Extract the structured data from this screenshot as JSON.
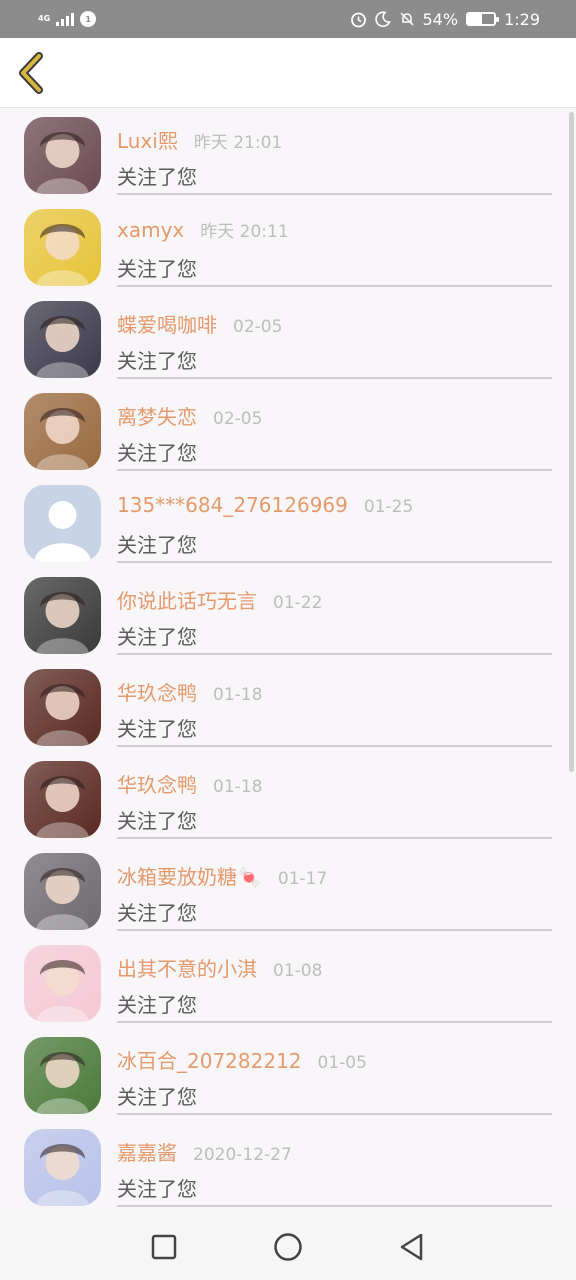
{
  "status_bar": {
    "network": "4G",
    "notification_badge": "1",
    "battery": "54%",
    "battery_level": 0.54,
    "time": "1:29"
  },
  "header": {
    "back_icon": "chevron-left-icon",
    "accent": "#d8b640"
  },
  "items": [
    {
      "name": "Luxi熙",
      "time": "昨天 21:01",
      "action": "关注了您",
      "avatar_color": "#6b4a52"
    },
    {
      "name": "xamyx",
      "time": "昨天 20:11",
      "action": "关注了您",
      "avatar_color": "#e8c43a"
    },
    {
      "name": "蝶爱喝咖啡",
      "time": "02-05",
      "action": "关注了您",
      "avatar_color": "#3b3a4a"
    },
    {
      "name": "离梦失恋",
      "time": "02-05",
      "action": "关注了您",
      "avatar_color": "#9a6a3e"
    },
    {
      "name": "135***684_276126969",
      "time": "01-25",
      "action": "关注了您",
      "avatar_color": "#c9d3e6"
    },
    {
      "name": "你说此话巧无言",
      "time": "01-22",
      "action": "关注了您",
      "avatar_color": "#3a3a3a"
    },
    {
      "name": "华玖念鸭",
      "time": "01-18",
      "action": "关注了您",
      "avatar_color": "#5a2a22"
    },
    {
      "name": "华玖念鸭",
      "time": "01-18",
      "action": "关注了您",
      "avatar_color": "#5a2a22"
    },
    {
      "name": "冰箱要放奶糖🍬",
      "time": "01-17",
      "action": "关注了您",
      "avatar_color": "#6d6a70"
    },
    {
      "name": "出其不意的小淇",
      "time": "01-08",
      "action": "关注了您",
      "avatar_color": "#f5c9d6"
    },
    {
      "name": "冰百合_207282212",
      "time": "01-05",
      "action": "关注了您",
      "avatar_color": "#4b7a3a"
    },
    {
      "name": "嘉嘉酱",
      "time": "2020-12-27",
      "action": "关注了您",
      "avatar_color": "#b9c2ea"
    }
  ],
  "nav": [
    "square-icon",
    "circle-home-icon",
    "triangle-back-icon"
  ]
}
